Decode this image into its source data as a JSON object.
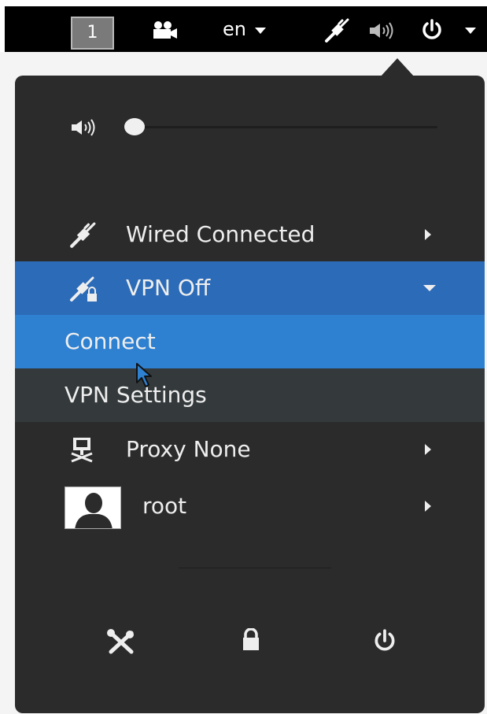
{
  "topbar": {
    "workspace_label": "1",
    "language_label": "en"
  },
  "volume": {
    "level": 0.0
  },
  "menu": {
    "wired_label": "Wired Connected",
    "vpn_label": "VPN Off",
    "vpn_submenu": {
      "connect_label": "Connect",
      "settings_label": "VPN Settings"
    },
    "proxy_label": "Proxy None",
    "user_label": "root"
  },
  "colors": {
    "panel_bg": "#000000",
    "menu_bg": "#2b2b2b",
    "vpn_row_bg": "#2c6bb8",
    "connect_row_bg": "#2e80d1",
    "settings_row_bg": "#343a3c",
    "text": "#eeeeee"
  }
}
